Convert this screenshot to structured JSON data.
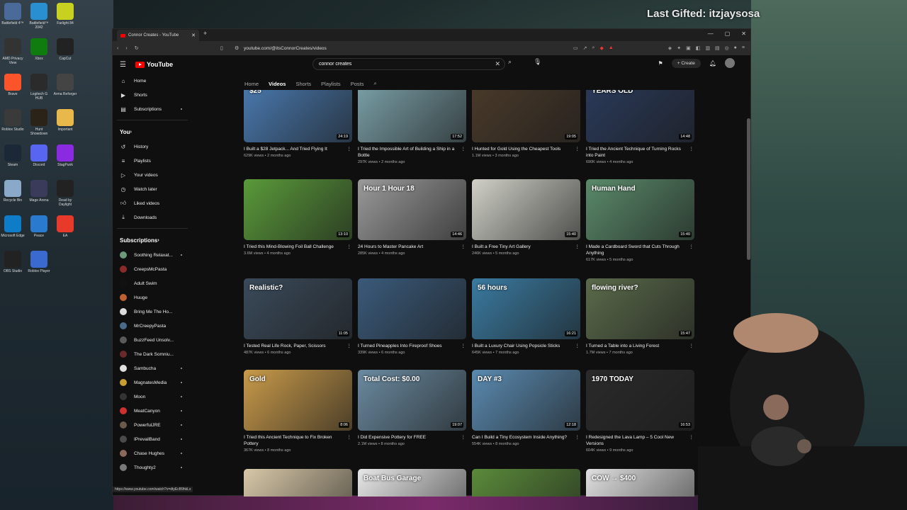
{
  "overlay": {
    "gifted": "Last Gifted: itzjaysosa"
  },
  "desktop_icons": [
    {
      "label": "Battlefield 4™",
      "color": "#4a6b9a"
    },
    {
      "label": "Battlefield™ 2042",
      "color": "#2a8fd0"
    },
    {
      "label": "Farlight 84",
      "color": "#c8d020"
    },
    {
      "label": "AMD Privacy View",
      "color": "#333333"
    },
    {
      "label": "Xbox",
      "color": "#107c10"
    },
    {
      "label": "CapCut",
      "color": "#222222"
    },
    {
      "label": "Brave",
      "color": "#fb542b"
    },
    {
      "label": "Logitech G HUB",
      "color": "#2b2b2b"
    },
    {
      "label": "Arma Reforger",
      "color": "#444444"
    },
    {
      "label": "Roblox Studio",
      "color": "#3a3a3a"
    },
    {
      "label": "Hunt Showdown",
      "color": "#2b2218"
    },
    {
      "label": "Important",
      "color": "#e8b84a"
    },
    {
      "label": "Steam",
      "color": "#1b2838"
    },
    {
      "label": "Discord",
      "color": "#5865f2"
    },
    {
      "label": "StagPunk",
      "color": "#8a2be2"
    },
    {
      "label": "Recycle Bin",
      "color": "#8aa8c8"
    },
    {
      "label": "Mage Arena",
      "color": "#3a3a5a"
    },
    {
      "label": "Dead by Daylight",
      "color": "#222222"
    },
    {
      "label": "Microsoft Edge",
      "color": "#0f7cc7"
    },
    {
      "label": "Peace",
      "color": "#2a7ad0"
    },
    {
      "label": "EA",
      "color": "#e83a2a"
    },
    {
      "label": "OBS Studio",
      "color": "#222222"
    },
    {
      "label": "Roblox Player",
      "color": "#3a6ad0"
    }
  ],
  "browser": {
    "tab_title": "Connor Creates - YouTube",
    "url": "youtube.com/@itsConnorCreates/videos"
  },
  "youtube": {
    "logo": "YouTube",
    "search_value": "connor creates",
    "create_label": "Create",
    "sidebar_main": [
      {
        "label": "Home",
        "icon": "home-icon"
      },
      {
        "label": "Shorts",
        "icon": "shorts-icon"
      },
      {
        "label": "Subscriptions",
        "icon": "subscriptions-icon"
      }
    ],
    "you_heading": "You",
    "sidebar_you": [
      {
        "label": "History",
        "icon": "history-icon"
      },
      {
        "label": "Playlists",
        "icon": "playlists-icon"
      },
      {
        "label": "Your videos",
        "icon": "your-videos-icon"
      },
      {
        "label": "Watch later",
        "icon": "watch-later-icon"
      },
      {
        "label": "Liked videos",
        "icon": "liked-videos-icon"
      },
      {
        "label": "Downloads",
        "icon": "downloads-icon"
      }
    ],
    "subs_heading": "Subscriptions",
    "subscriptions": [
      {
        "label": "Soothing Relaxat...",
        "color": "#6a9a7a"
      },
      {
        "label": "CreepsMcPasta",
        "color": "#8a2a2a"
      },
      {
        "label": "Adult Swim",
        "color": "#111111"
      },
      {
        "label": "Huuge",
        "color": "#c06030"
      },
      {
        "label": "Bring Me The Ho...",
        "color": "#dddddd"
      },
      {
        "label": "MrCreepyPasta",
        "color": "#4a6a8a"
      },
      {
        "label": "BuzzFeed Unsolv...",
        "color": "#5a5a5a"
      },
      {
        "label": "The Dark Somniu...",
        "color": "#6a2a2a"
      },
      {
        "label": "Sambucha",
        "color": "#e0e0e0"
      },
      {
        "label": "MagnatesMedia",
        "color": "#c8a030"
      },
      {
        "label": "Moon",
        "color": "#333333"
      },
      {
        "label": "MeatCanyon",
        "color": "#d03030"
      },
      {
        "label": "PowerfulJRE",
        "color": "#6a5a4a"
      },
      {
        "label": "IPrevailBand",
        "color": "#4a4a4a"
      },
      {
        "label": "Chase Hughes",
        "color": "#8a6a5a"
      },
      {
        "label": "Thoughty2",
        "color": "#7a7a7a"
      }
    ],
    "channel_tabs": [
      "Home",
      "Videos",
      "Shorts",
      "Playlists",
      "Posts"
    ],
    "active_tab": "Videos",
    "status_url": "https://www.youtube.com/watch?v=dtyEcB9hkLs"
  },
  "videos": [
    {
      "title": "I Built a $28 Jetpack... And Tried Flying It",
      "meta": "629K views • 2 months ago",
      "duration": "24:19",
      "overlay": "$25",
      "bg": "#4a7ab0"
    },
    {
      "title": "I Tried the Impossible Art of Building a Ship in a Bottle",
      "meta": "297K views • 2 months ago",
      "duration": "17:52",
      "overlay": "",
      "bg": "#7aa0a8"
    },
    {
      "title": "I Hunted for Gold Using the Cheapest Tools",
      "meta": "1.1M views • 3 months ago",
      "duration": "19:05",
      "overlay": "",
      "bg": "#4a3a2a"
    },
    {
      "title": "I Tried the Ancient Technique of Turning Rocks into Paint",
      "meta": "690K views • 4 months ago",
      "duration": "14:48",
      "overlay": "YEARS OLD",
      "bg": "#2a3a5a"
    },
    {
      "title": "I Tried this Mind-Blowing Foil Ball Challenge",
      "meta": "3.6M views • 4 months ago",
      "duration": "13:10",
      "overlay": "",
      "bg": "#5a9a3a"
    },
    {
      "title": "24 Hours to Master Pancake Art",
      "meta": "285K views • 4 months ago",
      "duration": "14:46",
      "overlay": "Hour 1 Hour 18",
      "bg": "#9a9a9a"
    },
    {
      "title": "I Built a Free Tiny Art Gallery",
      "meta": "246K views • 5 months ago",
      "duration": "15:40",
      "overlay": "",
      "bg": "#d0d0c8"
    },
    {
      "title": "I Made a Cardboard Sword that Cuts Through Anything",
      "meta": "617K views • 5 months ago",
      "duration": "15:40",
      "overlay": "Human Hand",
      "bg": "#5a8a6a"
    },
    {
      "title": "I Tested Real Life Rock, Paper, Scissors",
      "meta": "487K views • 6 months ago",
      "duration": "11:05",
      "overlay": "Realistic?",
      "bg": "#3a4a5a"
    },
    {
      "title": "I Turned Pineapples Into Fireproof Shoes",
      "meta": "339K views • 6 months ago",
      "duration": "",
      "overlay": "",
      "bg": "#3a5a7a"
    },
    {
      "title": "I Built a Luxury Chair Using Popsicle Sticks",
      "meta": "645K views • 7 months ago",
      "duration": "16:21",
      "overlay": "56 hours",
      "bg": "#3a7aa0"
    },
    {
      "title": "I Turned a Table into a Living Forest",
      "meta": "1.7M views • 7 months ago",
      "duration": "15:47",
      "overlay": "flowing river?",
      "bg": "#5a6a4a"
    },
    {
      "title": "I Tried this Ancient Technique to Fix Broken Pottery",
      "meta": "367K views • 8 months ago",
      "duration": "8:06",
      "overlay": "Gold",
      "bg": "#c89a4a"
    },
    {
      "title": "I Did Expensive Pottery for FREE",
      "meta": "2.1M views • 8 months ago",
      "duration": "19:07",
      "overlay": "Total Cost: $0.00",
      "bg": "#6a8aa0"
    },
    {
      "title": "Can I Build a Tiny Ecosystem Inside Anything?",
      "meta": "554K views • 8 months ago",
      "duration": "12:18",
      "overlay": "DAY #3",
      "bg": "#5a8ab0"
    },
    {
      "title": "I Redesigned the Lava Lamp – 5 Cool New Versions",
      "meta": "604K views • 9 months ago",
      "duration": "16:53",
      "overlay": "1970 TODAY",
      "bg": "#2a2a2a"
    },
    {
      "title": "",
      "meta": "",
      "duration": "",
      "overlay": "",
      "bg": "#d8c8a8"
    },
    {
      "title": "",
      "meta": "",
      "duration": "",
      "overlay": "Boat Bus Garage",
      "bg": "#e8e8e8"
    },
    {
      "title": "",
      "meta": "",
      "duration": "",
      "overlay": "",
      "bg": "#5a8a3a"
    },
    {
      "title": "",
      "meta": "",
      "duration": "",
      "overlay": "COW → $400",
      "bg": "#e0e0e0"
    }
  ]
}
